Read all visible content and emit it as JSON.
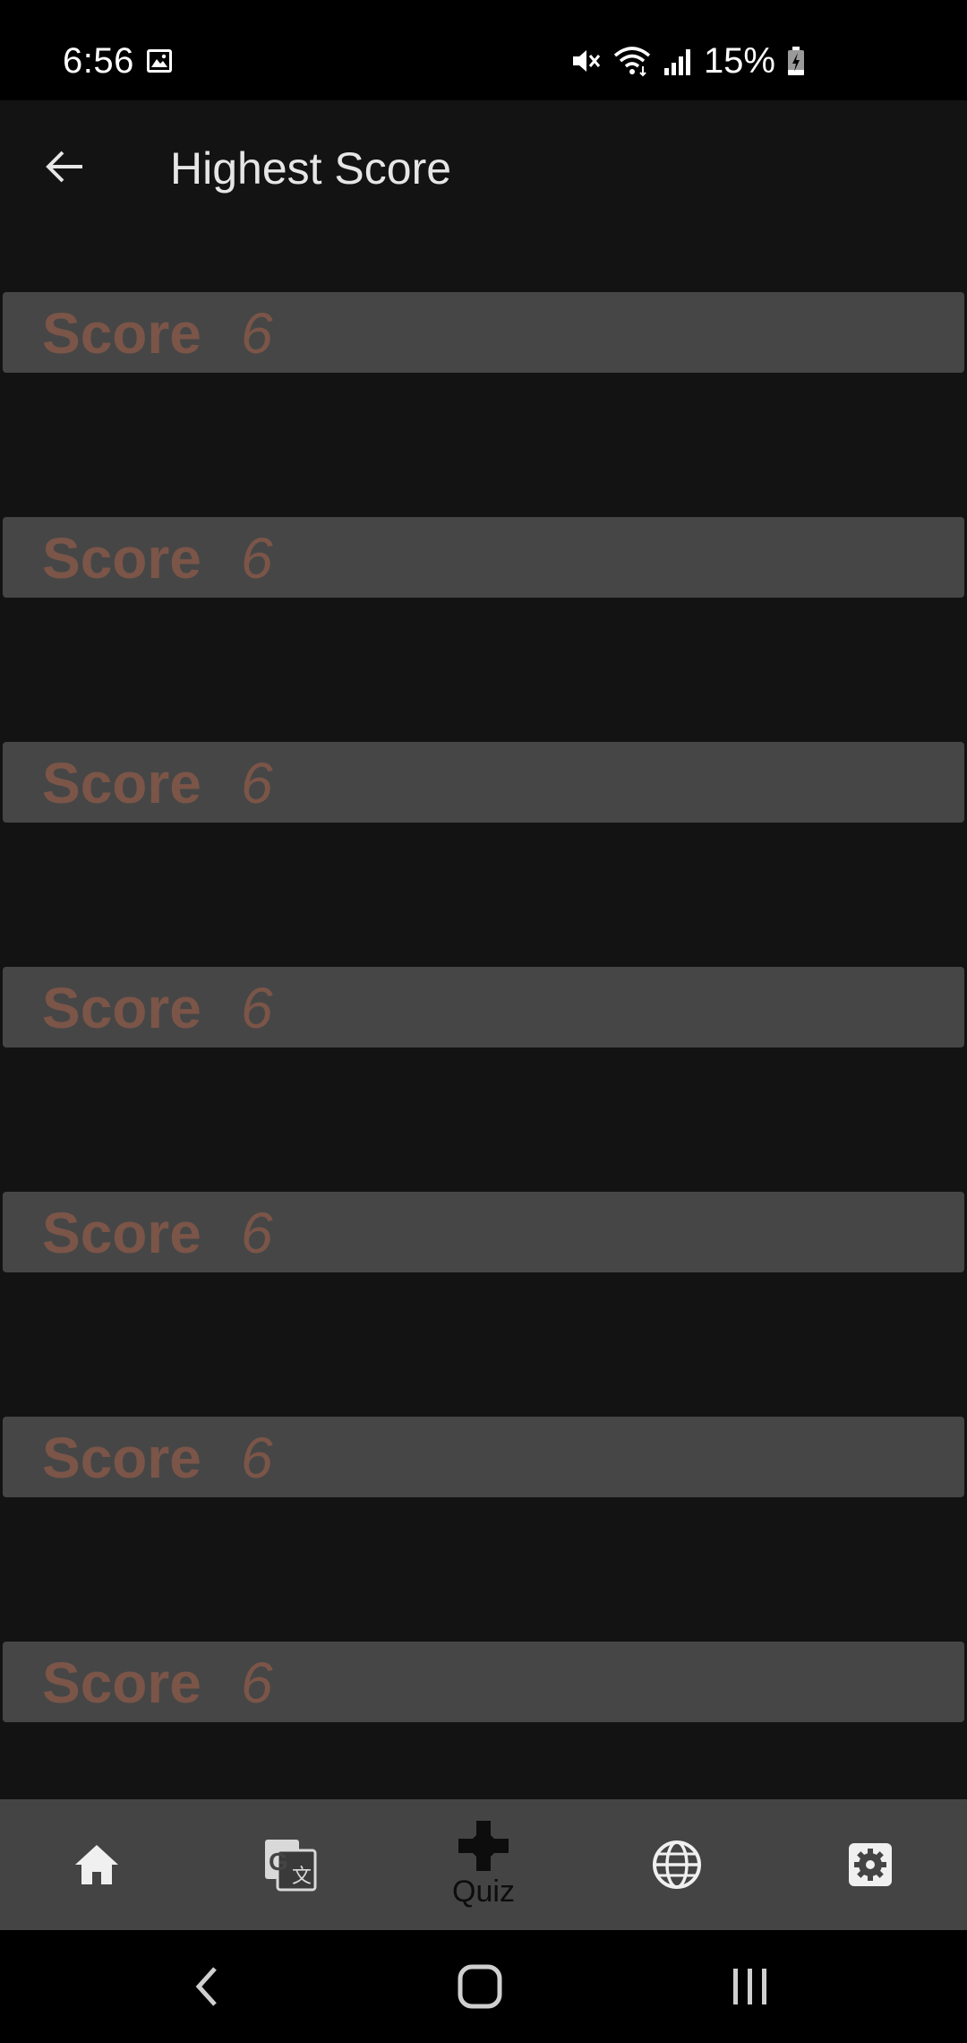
{
  "status_bar": {
    "time": "6:56",
    "battery": "15%",
    "icons": [
      "gallery-icon",
      "mute-icon",
      "wifi-icon",
      "signal-icon",
      "battery-charging-icon"
    ]
  },
  "app_bar": {
    "title": "Highest Score",
    "back_icon": "arrow-back-icon"
  },
  "scores": [
    {
      "label": "Score",
      "value": "6"
    },
    {
      "label": "Score",
      "value": "6"
    },
    {
      "label": "Score",
      "value": "6"
    },
    {
      "label": "Score",
      "value": "6"
    },
    {
      "label": "Score",
      "value": "6"
    },
    {
      "label": "Score",
      "value": "6"
    },
    {
      "label": "Score",
      "value": "6"
    }
  ],
  "bottom_nav": {
    "items": [
      {
        "icon": "home-icon",
        "label": ""
      },
      {
        "icon": "translate-icon",
        "label": ""
      },
      {
        "icon": "gamepad-icon",
        "label": "Quiz"
      },
      {
        "icon": "globe-icon",
        "label": ""
      },
      {
        "icon": "settings-icon",
        "label": ""
      }
    ]
  },
  "colors": {
    "background": "#131313",
    "row_background": "#464646",
    "score_text": "#7b5548",
    "nav_background": "#444444",
    "title_text": "#e6e6e6"
  }
}
